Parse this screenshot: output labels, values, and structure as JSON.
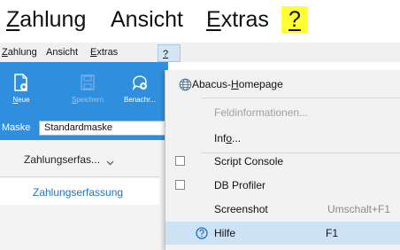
{
  "big_menubar": {
    "items": [
      {
        "pre": "",
        "u": "Z",
        "post": "ahlung"
      },
      {
        "pre": "Ansicht",
        "u": "",
        "post": ""
      },
      {
        "pre": "",
        "u": "E",
        "post": "xtras"
      },
      {
        "pre": "",
        "u": "?",
        "post": ""
      }
    ],
    "help_highlight": "#ffff33"
  },
  "small_menubar": {
    "items": [
      {
        "pre": "",
        "u": "Z",
        "post": "ahlung"
      },
      {
        "pre": "Ansicht",
        "u": "",
        "post": ""
      },
      {
        "pre": "",
        "u": "E",
        "post": "xtras"
      },
      {
        "pre": "",
        "u": "?",
        "post": ""
      }
    ]
  },
  "toolbar": {
    "buttons": [
      {
        "pre": "",
        "u": "N",
        "post": "eue",
        "icon": "new-document-icon",
        "enabled": true
      },
      {
        "pre": "",
        "u": "S",
        "post": "peichern",
        "icon": "save-icon",
        "enabled": false
      },
      {
        "pre": "Benachr...",
        "u": "",
        "post": "",
        "icon": "new-message-icon",
        "enabled": true
      }
    ],
    "ribbon_color": "#2f8fde"
  },
  "maske": {
    "label": "Maske",
    "value": "Standardmaske"
  },
  "sidebar": {
    "tab_label": "Zahlungserfas...",
    "tab_icon": "chevron-down-icon",
    "nav_items": [
      "Zahlungserfassung"
    ]
  },
  "help_menu": {
    "items": [
      {
        "pre": "Abacus-",
        "u": "H",
        "post": "omepage",
        "shortcut": "",
        "icon": "globe-icon",
        "enabled": true
      },
      {
        "pre": "Feldinformationen...",
        "u": "",
        "post": "",
        "shortcut": "",
        "enabled": false
      },
      {
        "pre": "Inf",
        "u": "o",
        "post": "...",
        "shortcut": "",
        "enabled": true
      },
      {
        "pre": "Script Console",
        "u": "",
        "post": "",
        "shortcut": "",
        "checkbox": true,
        "enabled": true
      },
      {
        "pre": "DB Profiler",
        "u": "",
        "post": "",
        "shortcut": "",
        "checkbox": true,
        "enabled": true
      },
      {
        "pre": "Screenshot",
        "u": "",
        "post": "",
        "shortcut": "Umschalt+F1",
        "enabled": true
      },
      {
        "pre": "Hilfe",
        "u": "",
        "post": "",
        "shortcut": "F1",
        "icon": "help-circle-icon",
        "enabled": true,
        "highlighted": true
      }
    ]
  }
}
